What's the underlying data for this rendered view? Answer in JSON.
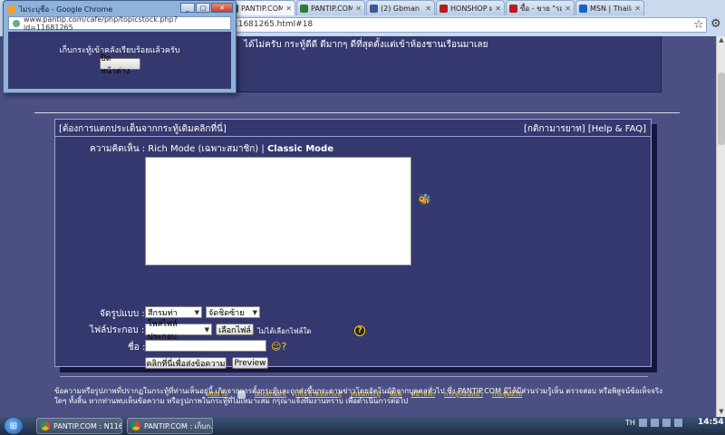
{
  "browser": {
    "tabs": [
      {
        "label": "PANTIP.COM : N",
        "color": "#2e7d32",
        "active": true
      },
      {
        "label": "PANTIP.COM ไม่",
        "color": "#2e7d32"
      },
      {
        "label": "(2) Gbman Bike",
        "color": "#3b5998"
      },
      {
        "label": "HONSHOP ผลาจ",
        "color": "#b71c1c"
      },
      {
        "label": "ซื้อ - ขาย \"รถ\" ม",
        "color": "#b71c1c"
      },
      {
        "label": "MSN | Thailand",
        "color": "#1565c0"
      }
    ],
    "address": "11681265.html#18"
  },
  "prev_post": {
    "text": "ได้ไม่ครับ กระทู้ดีดี  ดีมากๆ  ดีที่สุดตั้งแต่เข้าห้องชานเรือนมาเลย"
  },
  "reply": {
    "header_left": "[ต้องการแตกประเด็นจากกระทู้เดิมคลิกที่นี่]",
    "header_right": "[กติกามารยาท] [Help & FAQ]",
    "comment_label": "ความคิดเห็น :",
    "rich_mode": "Rich Mode (เฉพาะสมาชิก) |",
    "classic_mode": "Classic Mode",
    "format_label": "จัดรูปแบบ :",
    "format_select": "สีกรมท่า",
    "align_select": "จัดชิดซ้าย",
    "file_label": "ไฟล์ประกอบ :",
    "file_type_select": "โพสไฟล์ประกอบ",
    "choose_file_button": "เลือกไฟล์",
    "no_file_text": "ไม่ได้เลือกไฟล์ใด",
    "name_label": "ชื่อ :",
    "submit_button": "คลิกที่นี่เพื่อส่งข้อความ",
    "preview_button": "Preview"
  },
  "footer_links": {
    "add_to": "Add to",
    "items": [
      "bookmark",
      "เก็บเข้าคลังกระทู้",
      "ส่งต่อกระทู้",
      "พิมพ์",
      "หน้าหลัก",
      "กระทู้ก่อนหน้า",
      "กระทู้ต่อไป"
    ]
  },
  "disclaimer": "ข้อความหรือรูปภาพที่ปรากฏในกระทู้ที่ท่านเห็นอยู่นี้ เกิดจากการตั้งกระทู้และถูกส่งขึ้นกระดานข่าวโดยอัตโนมัติจากบุคคลทั่วไป ซึ่ง PANTIP.COM มิได้มีส่วนร่วมรู้เห็น ตรวจสอบ หรือพิสูจน์ข้อเท็จจริงใดๆ ทั้งสิ้น หากท่านพบเห็นข้อความ หรือรูปภาพในกระทู้ที่ไม่เหมาะสม กรุณาแจ้งทีมงานทราบ เพื่อดำเนินการต่อไป",
  "popup": {
    "title": "ไม่ระบุชื่อ - Google Chrome",
    "url": "www.pantip.com/cafe/php/topicstock.php?id=11681265",
    "message": "เก็บกระทู้เข้าคลังเรียบร้อยแล้วครับ",
    "close_button": "ปิดหน้าต่าง"
  },
  "taskbar": {
    "tasks": [
      "PANTIP.COM : N116...",
      "PANTIP.COM : เก็บก..."
    ],
    "lang": "TH",
    "clock": "14:54"
  }
}
